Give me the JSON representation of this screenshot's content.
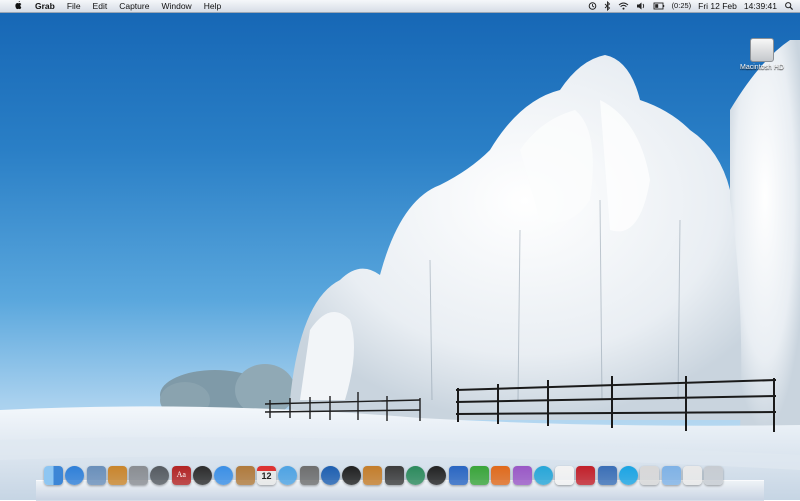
{
  "menubar": {
    "app_name": "Grab",
    "menus": [
      "File",
      "Edit",
      "Capture",
      "Window",
      "Help"
    ],
    "battery_time": "(0:25)",
    "date": "Fri 12 Feb",
    "time": "14:39:41",
    "status_icons": [
      "time-machine-icon",
      "bluetooth-icon",
      "wifi-icon",
      "volume-icon",
      "battery-icon"
    ]
  },
  "desktop": {
    "drive_label": "Macintosh HD"
  },
  "dock": {
    "apps": [
      {
        "name": "finder-icon",
        "color": "#3f8fe0"
      },
      {
        "name": "safari-icon",
        "color": "#2f7fd8"
      },
      {
        "name": "preview-icon",
        "color": "#6a8fba"
      },
      {
        "name": "iphoto-icon",
        "color": "#c9852c"
      },
      {
        "name": "system-preferences-icon",
        "color": "#8a8d92"
      },
      {
        "name": "dvd-player-icon",
        "color": "#555a60"
      },
      {
        "name": "dictionary-icon",
        "color": "#b32424"
      },
      {
        "name": "dashboard-icon",
        "color": "#2c2c2c"
      },
      {
        "name": "ichat-icon",
        "color": "#3b8fe6"
      },
      {
        "name": "address-book-icon",
        "color": "#b07a3c"
      },
      {
        "name": "ical-icon",
        "color": "#e8e8e8"
      },
      {
        "name": "itunes-icon",
        "color": "#4ea3e3"
      },
      {
        "name": "imovie-icon",
        "color": "#6e6e6e"
      },
      {
        "name": "quicktime-icon",
        "color": "#1e5fb0"
      },
      {
        "name": "front-row-icon",
        "color": "#202020"
      },
      {
        "name": "garageband-icon",
        "color": "#c47d2b"
      },
      {
        "name": "spaces-icon",
        "color": "#3c3c3c"
      },
      {
        "name": "time-machine-app-icon",
        "color": "#2c8a5c"
      },
      {
        "name": "photo-booth-icon",
        "color": "#222222"
      },
      {
        "name": "word-icon",
        "color": "#2a66c2"
      },
      {
        "name": "excel-icon",
        "color": "#3aa53a"
      },
      {
        "name": "powerpoint-icon",
        "color": "#e06a1c"
      },
      {
        "name": "entourage-icon",
        "color": "#9a58c6"
      },
      {
        "name": "messenger-icon",
        "color": "#27a6d8"
      },
      {
        "name": "textedit-icon",
        "color": "#f3f3f3"
      },
      {
        "name": "book-app-icon",
        "color": "#c2202a"
      },
      {
        "name": "network-icon",
        "color": "#3b6fb6"
      },
      {
        "name": "skype-icon",
        "color": "#1ba4e3"
      },
      {
        "name": "script-icon",
        "color": "#d8d8d8"
      },
      {
        "name": "applications-folder-icon",
        "color": "#7fb2e6"
      },
      {
        "name": "documents-stack-icon",
        "color": "#e9e9e9"
      },
      {
        "name": "trash-icon",
        "color": "#c7ccd2"
      }
    ],
    "ical_day": "12",
    "dictionary_text": "Aa"
  }
}
